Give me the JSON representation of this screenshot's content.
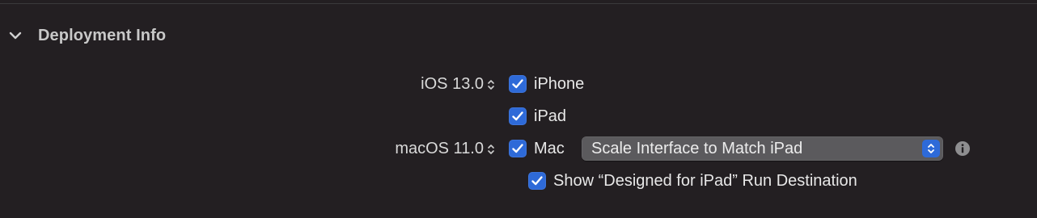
{
  "section": {
    "title": "Deployment Info"
  },
  "ios": {
    "version_label": "iOS 13.0",
    "devices": [
      {
        "label": "iPhone",
        "checked": true
      },
      {
        "label": "iPad",
        "checked": true
      }
    ]
  },
  "macos": {
    "version_label": "macOS 11.0",
    "mac_label": "Mac",
    "mac_checked": true,
    "interface_option": "Scale Interface to Match iPad"
  },
  "designed_for_ipad": {
    "label": "Show “Designed for iPad” Run Destination",
    "checked": true
  },
  "colors": {
    "background": "#231f22",
    "checkbox_accent": "#2e6ad8",
    "popup_background": "#5b5a5d",
    "header_text": "#c8c8c8"
  },
  "icons": {
    "disclosure": "chevron-down-icon",
    "stepper": "up-down-arrows-icon",
    "checkmark": "checkmark-icon",
    "info": "info-circle-icon"
  }
}
